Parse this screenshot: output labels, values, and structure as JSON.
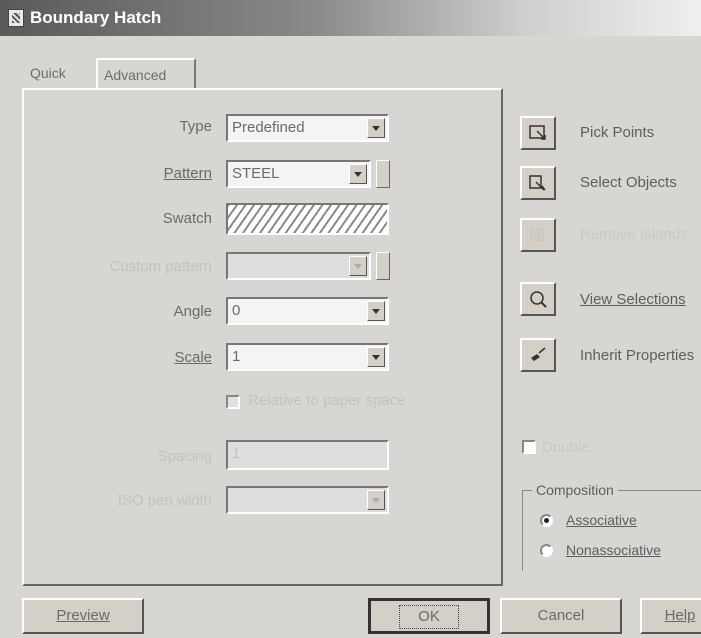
{
  "window": {
    "title": "Boundary Hatch"
  },
  "tabs": [
    {
      "label": "Quick"
    },
    {
      "label": "Advanced"
    }
  ],
  "form": {
    "type": {
      "label": "Type",
      "value": "Predefined"
    },
    "pattern": {
      "label": "Pattern",
      "value": "STEEL"
    },
    "swatch": {
      "label": "Swatch"
    },
    "custom_pattern": {
      "label": "Custom pattern"
    },
    "angle": {
      "label": "Angle",
      "value": "0"
    },
    "scale": {
      "label": "Scale",
      "value": "1"
    },
    "relative_paper": {
      "label": "Relative to paper space"
    },
    "spacing": {
      "label": "Spacing",
      "value": "1"
    },
    "iso_pen": {
      "label": "ISO pen width"
    }
  },
  "side": {
    "pick_points": "Pick Points",
    "select_objects": "Select Objects",
    "remove_islands": "Remove Islands",
    "view_selections": "View Selections",
    "inherit_properties": "Inherit Properties",
    "double": "Double"
  },
  "composition": {
    "label": "Composition",
    "associative": "Associative",
    "nonassociative": "Nonassociative",
    "selected": "Associative"
  },
  "buttons": {
    "preview": "Preview",
    "ok": "OK",
    "cancel": "Cancel",
    "help": "Help"
  }
}
